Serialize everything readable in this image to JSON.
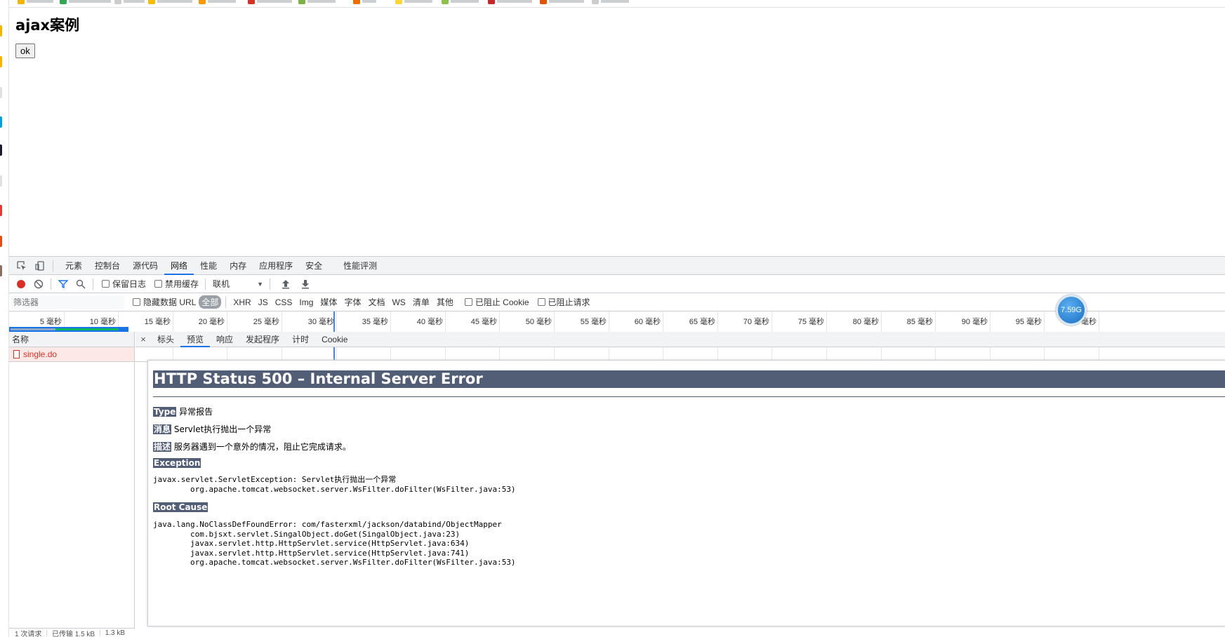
{
  "page": {
    "heading": "ajax案例",
    "ok_button": "ok"
  },
  "devtools": {
    "tabs": [
      "元素",
      "控制台",
      "源代码",
      "网络",
      "性能",
      "内存",
      "应用程序",
      "安全",
      "性能评测"
    ],
    "active_tab": "网络",
    "toolbar": {
      "preserve_log": "保留日志",
      "disable_cache": "禁用缓存",
      "throttle": "联机",
      "throttle_arrow": "▼"
    },
    "filter": {
      "placeholder": "筛选器",
      "hide_data_url": "隐藏数据 URL",
      "types": [
        "全部",
        "XHR",
        "JS",
        "CSS",
        "Img",
        "媒体",
        "字体",
        "文档",
        "WS",
        "清单",
        "其他"
      ],
      "blocked_cookies": "已阻止 Cookie",
      "blocked_requests": "已阻止请求"
    },
    "timeline": {
      "ticks": [
        "5 毫秒",
        "10 毫秒",
        "15 毫秒",
        "20 毫秒",
        "25 毫秒",
        "30 毫秒",
        "35 毫秒",
        "40 毫秒",
        "45 毫秒",
        "50 毫秒",
        "55 毫秒",
        "60 毫秒",
        "65 毫秒",
        "70 毫秒",
        "75 毫秒",
        "80 毫秒",
        "85 毫秒",
        "90 毫秒",
        "95 毫秒",
        "100 毫秒"
      ]
    },
    "gauge": "7.59G",
    "requests": {
      "header": "名称",
      "items": [
        "single.do"
      ],
      "status": [
        "1 次请求",
        "已传输 1.5 kB",
        "1.3 kB"
      ]
    },
    "detail": {
      "close": "×",
      "tabs": [
        "标头",
        "预览",
        "响应",
        "发起程序",
        "计时",
        "Cookie"
      ],
      "active_tab": "预览"
    },
    "error_page": {
      "title": "HTTP Status 500 – Internal Server Error",
      "type_label": "Type",
      "type_value": " 异常报告",
      "message_label": "消息",
      "message_value": " Servlet执行抛出一个异常",
      "desc_label": "描述",
      "desc_value": " 服务器遇到一个意外的情况，阻止它完成请求。",
      "exception_label": "Exception",
      "exception_trace": "javax.servlet.ServletException: Servlet执行抛出一个异常\n\torg.apache.tomcat.websocket.server.WsFilter.doFilter(WsFilter.java:53)",
      "root_cause_label": "Root Cause",
      "root_cause_trace": "java.lang.NoClassDefFoundError: com/fasterxml/jackson/databind/ObjectMapper\n\tcom.bjsxt.servlet.SingalObject.doGet(SingalObject.java:23)\n\tjavax.servlet.http.HttpServlet.service(HttpServlet.java:634)\n\tjavax.servlet.http.HttpServlet.service(HttpServlet.java:741)\n\torg.apache.tomcat.websocket.server.WsFilter.doFilter(WsFilter.java:53)"
    }
  },
  "colors": {
    "accent": "#1a73e8",
    "error_header": "#525d76",
    "error_row": "#fce8e6",
    "record_red": "#d93025"
  }
}
